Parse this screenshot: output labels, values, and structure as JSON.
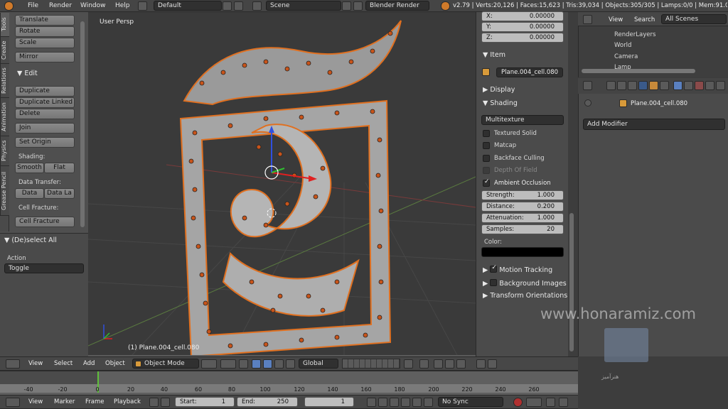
{
  "topbar": {
    "menus": [
      "File",
      "Render",
      "Window",
      "Help"
    ],
    "layout": "Default",
    "scene": "Scene",
    "engine": "Blender Render",
    "stats": "v2.79 | Verts:20,126 | Faces:15,623 | Tris:39,034 | Objects:305/305 | Lamps:0/0 | Mem:91.08M"
  },
  "tool_tabs": [
    "Tools",
    "Create",
    "Relations",
    "Animation",
    "Physics",
    "Grease Pencil"
  ],
  "tools": {
    "transform": [
      "Translate",
      "Rotate",
      "Scale"
    ],
    "mirror": "Mirror",
    "edit_header": "Edit",
    "duplicate": "Duplicate",
    "duplicate_linked": "Duplicate Linked",
    "delete": "Delete",
    "join": "Join",
    "set_origin": "Set Origin",
    "shading_label": "Shading:",
    "smooth": "Smooth",
    "flat": "Flat",
    "data_transfer_label": "Data Transfer:",
    "data": "Data",
    "data_la": "Data La",
    "cell_fracture_label": "Cell Fracture:",
    "cell_fracture": "Cell Fracture"
  },
  "operator": {
    "title": "(De)select All",
    "action_label": "Action",
    "action_value": "Toggle"
  },
  "viewport": {
    "view_name": "User Persp",
    "object_info": "(1) Plane.004_cell.080",
    "watermark": "www.honaramiz.com",
    "logo_text": "هنرآمیز"
  },
  "npanel": {
    "x": {
      "label": "X:",
      "value": "0.00000"
    },
    "y": {
      "label": "Y:",
      "value": "0.00000"
    },
    "z": {
      "label": "Z:",
      "value": "0.00000"
    },
    "item_header": "Item",
    "item_name": "Plane.004_cell.080",
    "display_header": "Display",
    "shading_header": "Shading",
    "shading_mode": "Multitexture",
    "checks": [
      {
        "label": "Textured Solid",
        "on": false
      },
      {
        "label": "Matcap",
        "on": false
      },
      {
        "label": "Backface Culling",
        "on": false
      },
      {
        "label": "Depth Of Field",
        "on": false
      },
      {
        "label": "Ambient Occlusion",
        "on": true
      }
    ],
    "ao": [
      {
        "label": "Strength:",
        "value": "1.000"
      },
      {
        "label": "Distance:",
        "value": "0.200"
      },
      {
        "label": "Attenuation:",
        "value": "1.000"
      },
      {
        "label": "Samples:",
        "value": "20"
      }
    ],
    "color_label": "Color:",
    "motion_tracking": "Motion Tracking",
    "background_images": "Background Images",
    "transform_orientations": "Transform Orientations"
  },
  "outliner": {
    "view": "View",
    "search": "Search",
    "filter": "All Scenes",
    "items": [
      "RenderLayers",
      "World",
      "Camera",
      "Lamp"
    ]
  },
  "properties": {
    "object_name": "Plane.004_cell.080",
    "add_modifier": "Add Modifier"
  },
  "view3d_header": {
    "menus": [
      "View",
      "Select",
      "Add",
      "Object"
    ],
    "mode": "Object Mode",
    "orientation": "Global"
  },
  "timeline": {
    "ticks": [
      "-40",
      "-20",
      "0",
      "20",
      "40",
      "60",
      "80",
      "100",
      "120",
      "140",
      "160",
      "180",
      "200",
      "220",
      "240",
      "260"
    ],
    "menus": [
      "View",
      "Marker",
      "Frame",
      "Playback"
    ],
    "start_label": "Start:",
    "start": "1",
    "end_label": "End:",
    "end": "250",
    "current": "1",
    "sync": "No Sync"
  }
}
